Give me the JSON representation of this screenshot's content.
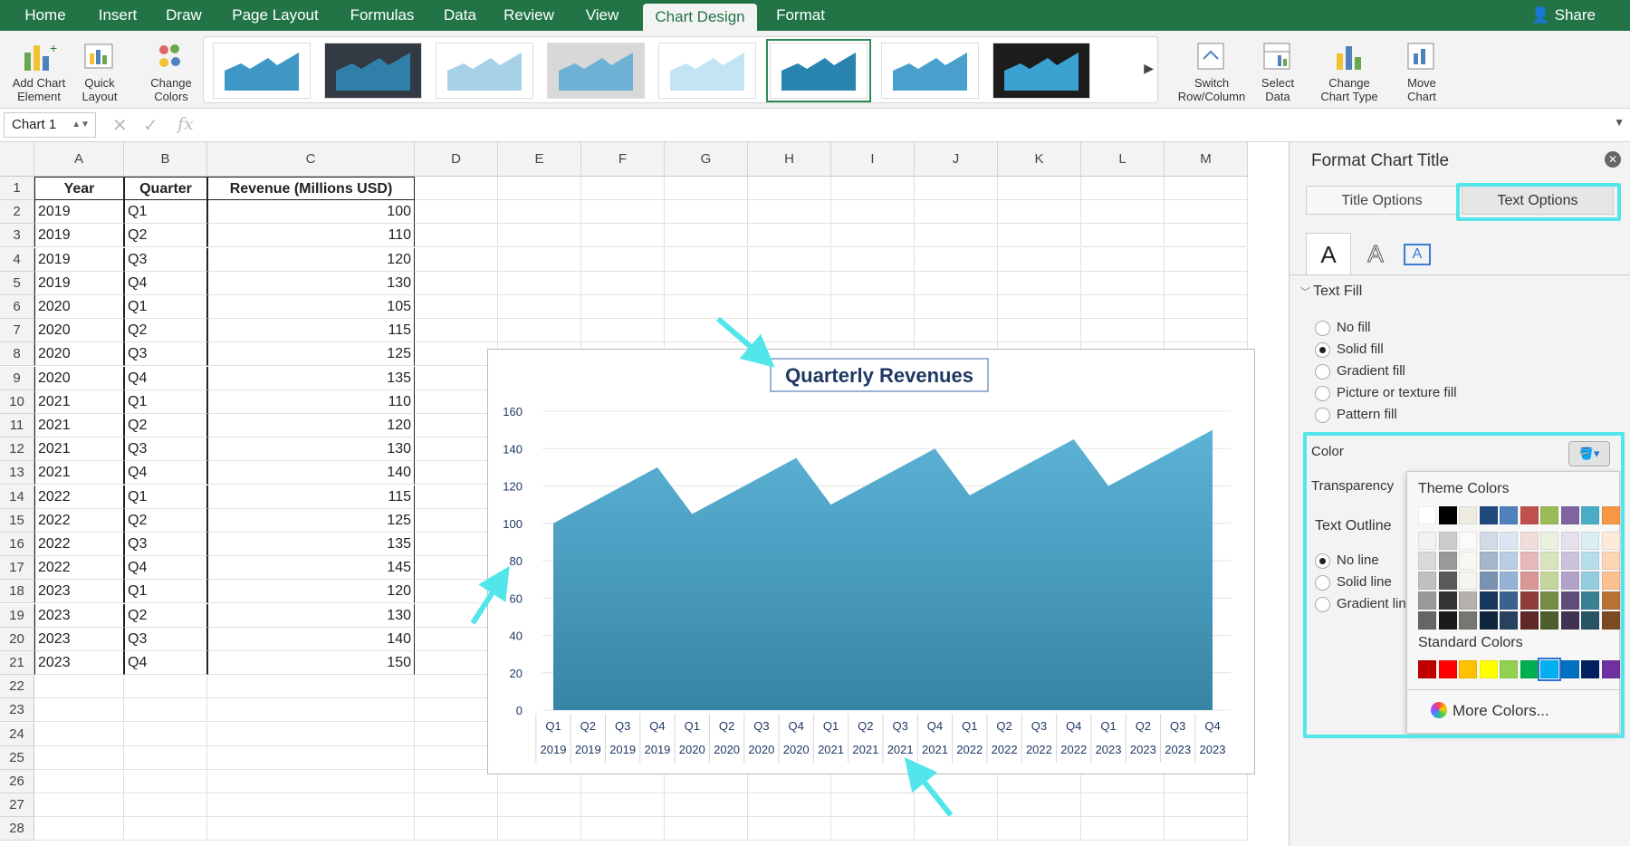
{
  "tabs": [
    "Home",
    "Insert",
    "Draw",
    "Page Layout",
    "Formulas",
    "Data",
    "Review",
    "View",
    "Chart Design",
    "Format"
  ],
  "share_label": "Share",
  "ribbon": {
    "add_chart_element": "Add Chart Element",
    "quick_layout": "Quick Layout",
    "change_colors": "Change Colors",
    "switch_row_column": "Switch Row/Column",
    "select_data": "Select Data",
    "change_chart_type": "Change Chart Type",
    "move_chart": "Move Chart"
  },
  "name_box": "Chart 1",
  "columns": [
    "A",
    "B",
    "C",
    "D",
    "E",
    "F",
    "G",
    "H",
    "I",
    "J",
    "K",
    "L",
    "M"
  ],
  "table": {
    "headers": [
      "Year",
      "Quarter",
      "Revenue (Millions USD)"
    ],
    "rows": [
      [
        "2019",
        "Q1",
        "100"
      ],
      [
        "2019",
        "Q2",
        "110"
      ],
      [
        "2019",
        "Q3",
        "120"
      ],
      [
        "2019",
        "Q4",
        "130"
      ],
      [
        "2020",
        "Q1",
        "105"
      ],
      [
        "2020",
        "Q2",
        "115"
      ],
      [
        "2020",
        "Q3",
        "125"
      ],
      [
        "2020",
        "Q4",
        "135"
      ],
      [
        "2021",
        "Q1",
        "110"
      ],
      [
        "2021",
        "Q2",
        "120"
      ],
      [
        "2021",
        "Q3",
        "130"
      ],
      [
        "2021",
        "Q4",
        "140"
      ],
      [
        "2022",
        "Q1",
        "115"
      ],
      [
        "2022",
        "Q2",
        "125"
      ],
      [
        "2022",
        "Q3",
        "135"
      ],
      [
        "2022",
        "Q4",
        "145"
      ],
      [
        "2023",
        "Q1",
        "120"
      ],
      [
        "2023",
        "Q2",
        "130"
      ],
      [
        "2023",
        "Q3",
        "140"
      ],
      [
        "2023",
        "Q4",
        "150"
      ]
    ]
  },
  "row_numbers": [
    "1",
    "2",
    "3",
    "4",
    "5",
    "6",
    "7",
    "8",
    "9",
    "10",
    "11",
    "12",
    "13",
    "14",
    "15",
    "16",
    "17",
    "18",
    "19",
    "20",
    "21",
    "22",
    "23",
    "24",
    "25",
    "26",
    "27",
    "28"
  ],
  "chart_data": {
    "type": "area",
    "title": "Quarterly Revenues",
    "quarters": [
      "Q1",
      "Q2",
      "Q3",
      "Q4",
      "Q1",
      "Q2",
      "Q3",
      "Q4",
      "Q1",
      "Q2",
      "Q3",
      "Q4",
      "Q1",
      "Q2",
      "Q3",
      "Q4",
      "Q1",
      "Q2",
      "Q3",
      "Q4"
    ],
    "years": [
      "2019",
      "2019",
      "2019",
      "2019",
      "2020",
      "2020",
      "2020",
      "2020",
      "2021",
      "2021",
      "2021",
      "2021",
      "2022",
      "2022",
      "2022",
      "2022",
      "2023",
      "2023",
      "2023",
      "2023"
    ],
    "values": [
      100,
      110,
      120,
      130,
      105,
      115,
      125,
      135,
      110,
      120,
      130,
      140,
      115,
      125,
      135,
      145,
      120,
      130,
      140,
      150
    ],
    "ylim": [
      0,
      160
    ],
    "yticks": [
      "0",
      "20",
      "40",
      "60",
      "80",
      "100",
      "120",
      "140",
      "160"
    ],
    "fill": "#4da8cc"
  },
  "pane": {
    "title": "Format Chart Title",
    "tab_title_options": "Title Options",
    "tab_text_options": "Text Options",
    "text_fill": "Text Fill",
    "fill_options": [
      "No fill",
      "Solid fill",
      "Gradient fill",
      "Picture or texture fill",
      "Pattern fill"
    ],
    "color_label": "Color",
    "transparency_label": "Transparency",
    "text_outline": "Text Outline",
    "outline_options": [
      "No line",
      "Solid line",
      "Gradient lin"
    ]
  },
  "picker": {
    "theme_colors": "Theme Colors",
    "standard_colors": "Standard Colors",
    "more_colors": "More Colors...",
    "theme_top": [
      "#ffffff",
      "#000000",
      "#eeece1",
      "#1f497d",
      "#4f81bd",
      "#c0504d",
      "#9bbb59",
      "#8064a2",
      "#4bacc6",
      "#f79646"
    ],
    "standard": [
      "#c00000",
      "#ff0000",
      "#ffc000",
      "#ffff00",
      "#92d050",
      "#00b050",
      "#00b0f0",
      "#0070c0",
      "#002060",
      "#7030a0"
    ]
  }
}
